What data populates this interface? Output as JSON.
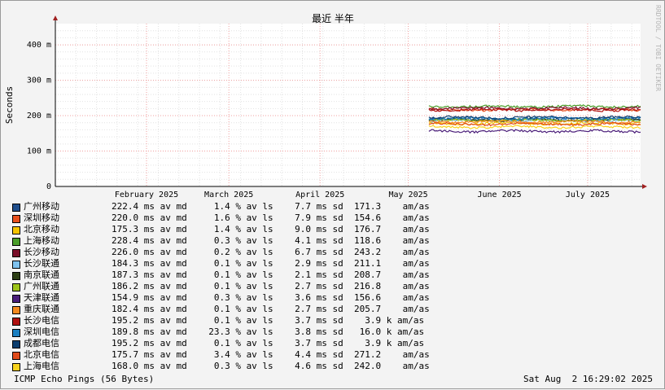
{
  "chart_data": {
    "type": "line",
    "title": "最近 半年",
    "ylabel": "Seconds",
    "ylim": [
      0,
      460
    ],
    "yticks": [
      {
        "v": 0,
        "label": "0"
      },
      {
        "v": 100,
        "label": "100 m"
      },
      {
        "v": 200,
        "label": "200 m"
      },
      {
        "v": 300,
        "label": "300 m"
      },
      {
        "v": 400,
        "label": "400 m"
      }
    ],
    "x_range": [
      "2025-01-15",
      "2025-08-02"
    ],
    "x_ticks": [
      {
        "date": "2025-02-15",
        "label": "February 2025"
      },
      {
        "date": "2025-03-15",
        "label": "March 2025"
      },
      {
        "date": "2025-04-15",
        "label": "April 2025"
      },
      {
        "date": "2025-05-15",
        "label": "May 2025"
      },
      {
        "date": "2025-06-15",
        "label": "June 2025"
      },
      {
        "date": "2025-07-15",
        "label": "July 2025"
      }
    ],
    "data_start": "2025-05-22",
    "watermark": "RRDTOOL / TOBI OETIKER",
    "series": [
      {
        "name": "广州移动",
        "color": "#1f4e8c",
        "avg": 190,
        "stats": "222.4 ms av md     1.4 % av ls    7.7 ms sd  171.3    am/as"
      },
      {
        "name": "深圳移动",
        "color": "#e8501e",
        "avg": 217,
        "stats": "220.0 ms av md     1.6 % av ls    7.9 ms sd  154.6    am/as"
      },
      {
        "name": "北京移动",
        "color": "#f5c400",
        "avg": 178,
        "stats": "175.3 ms av md     1.4 % av ls    9.0 ms sd  176.7    am/as"
      },
      {
        "name": "上海移动",
        "color": "#4a9e2a",
        "avg": 226,
        "stats": "228.4 ms av md     0.3 % av ls    4.1 ms sd  118.6    am/as"
      },
      {
        "name": "长沙移动",
        "color": "#7a0f2a",
        "avg": 221,
        "stats": "226.0 ms av md     0.2 % av ls    6.7 ms sd  243.2    am/as"
      },
      {
        "name": "长沙联通",
        "color": "#7fc3f0",
        "avg": 186,
        "stats": "184.3 ms av md     0.1 % av ls    2.9 ms sd  211.1    am/as"
      },
      {
        "name": "南京联通",
        "color": "#2c3e14",
        "avg": 188,
        "stats": "187.3 ms av md     0.1 % av ls    2.1 ms sd  208.7    am/as"
      },
      {
        "name": "广州联通",
        "color": "#9dc41a",
        "avg": 187,
        "stats": "186.2 ms av md     0.1 % av ls    2.7 ms sd  216.8    am/as"
      },
      {
        "name": "天津联通",
        "color": "#4b1e7a",
        "avg": 156,
        "stats": "154.9 ms av md     0.3 % av ls    3.6 ms sd  156.6    am/as"
      },
      {
        "name": "重庆联通",
        "color": "#f58a1f",
        "avg": 183,
        "stats": "182.4 ms av md     0.1 % av ls    2.7 ms sd  205.7    am/as"
      },
      {
        "name": "长沙电信",
        "color": "#b01010",
        "avg": 216,
        "stats": "195.2 ms av md     0.1 % av ls    3.7 ms sd    3.9 k am/as"
      },
      {
        "name": "深圳电信",
        "color": "#1a7fc1",
        "avg": 192,
        "stats": "189.8 ms av md    23.3 % av ls    3.8 ms sd   16.0 k am/as"
      },
      {
        "name": "成都电信",
        "color": "#0b3d6e",
        "avg": 195,
        "stats": "195.2 ms av md     0.1 % av ls    3.7 ms sd    3.9 k am/as"
      },
      {
        "name": "北京电信",
        "color": "#e04a1a",
        "avg": 176,
        "stats": "175.7 ms av md     3.4 % av ls    4.4 ms sd  271.2    am/as"
      },
      {
        "name": "上海电信",
        "color": "#f7d21e",
        "avg": 168,
        "stats": "168.0 ms av md     0.3 % av ls    4.6 ms sd  242.0    am/as"
      }
    ]
  },
  "footer": {
    "left": "ICMP Echo Pings (56 Bytes)",
    "right": "Sat Aug  2 16:29:02 2025"
  }
}
